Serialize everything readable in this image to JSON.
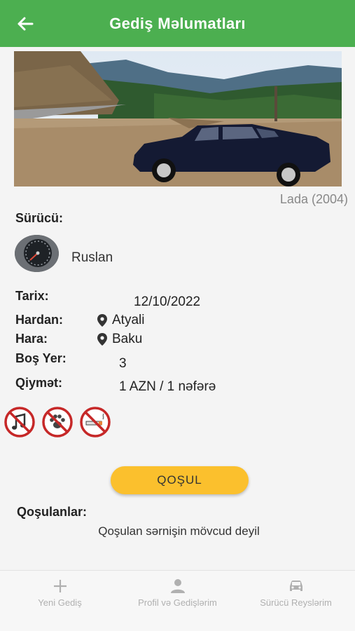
{
  "header": {
    "title": "Gediş Məlumatları",
    "back_icon": "arrow-left-icon",
    "color": "#4caf50"
  },
  "car": {
    "caption": "Lada (2004)"
  },
  "driver": {
    "label": "Sürücü:",
    "name": "Ruslan"
  },
  "trip": {
    "date_label": "Tarix:",
    "date_value": "12/10/2022",
    "from_label": "Hardan:",
    "from_value": "Atyali",
    "to_label": "Hara:",
    "to_value": "Baku",
    "seats_label": "Boş Yer:",
    "seats_value": "3",
    "price_label": "Qiymət:",
    "price_value": "1 AZN / 1 nəfərə"
  },
  "rules": [
    {
      "icon": "no-music-icon"
    },
    {
      "icon": "no-pets-icon"
    },
    {
      "icon": "no-smoking-icon"
    }
  ],
  "join_button": {
    "label": "QOŞUL",
    "color": "#fbc02d"
  },
  "joined": {
    "title": "Qoşulanlar:",
    "empty_text": "Qoşulan sərnişin mövcud deyil"
  },
  "bottom_nav": [
    {
      "label": "Yeni Gediş",
      "icon": "plus-icon"
    },
    {
      "label": "Profil və Gedişlərim",
      "icon": "person-icon"
    },
    {
      "label": "Sürücü Reyslərim",
      "icon": "car-icon"
    }
  ]
}
